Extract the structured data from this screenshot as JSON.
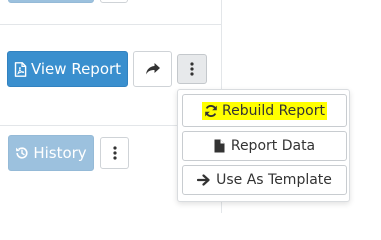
{
  "rows": [
    {
      "primary_button": {
        "label": ""
      },
      "has_menu_button": true
    },
    {
      "primary_button": {
        "label": "View Report",
        "icon": "pdf-file-icon"
      },
      "share_icon": "share-arrow-icon",
      "menu_icon": "vertical-ellipsis-icon"
    },
    {
      "primary_button": {
        "label": "History",
        "icon": "history-icon"
      },
      "menu_icon": "vertical-ellipsis-icon"
    }
  ],
  "dropdown": {
    "items": [
      {
        "label": "Rebuild Report",
        "icon": "refresh-icon",
        "highlighted": true,
        "highlight_color": "#ffff00"
      },
      {
        "label": "Report Data",
        "icon": "file-icon"
      },
      {
        "label": "Use As Template",
        "icon": "arrow-right-icon"
      }
    ]
  },
  "colors": {
    "primary": "#3a8fce",
    "primary_disabled": "#9cc1de",
    "highlight": "#ffff00"
  }
}
